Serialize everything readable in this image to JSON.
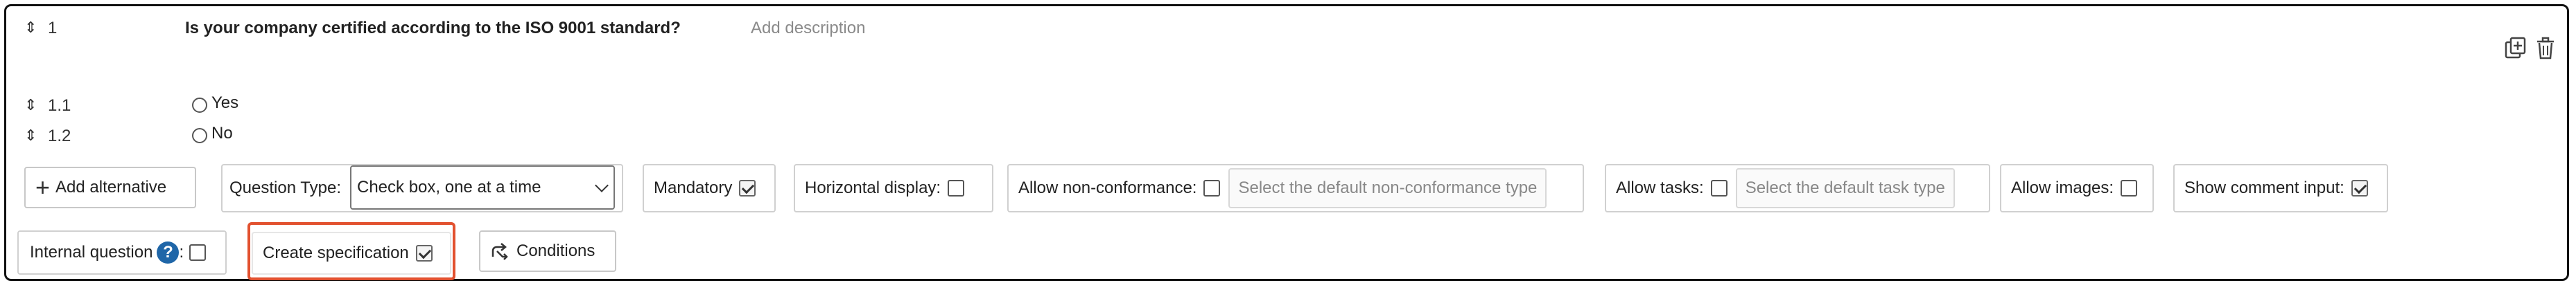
{
  "question": {
    "number": "1",
    "text": "Is your company certified according to the ISO 9001 standard?",
    "description_placeholder": "Add description"
  },
  "alternatives": [
    {
      "number": "1.1",
      "label": "Yes"
    },
    {
      "number": "1.2",
      "label": "No"
    }
  ],
  "toolbar": {
    "add_alternative": "Add alternative",
    "question_type_label": "Question Type:",
    "question_type_value": "Check box, one at a time",
    "mandatory_label": "Mandatory",
    "mandatory_checked": true,
    "horizontal_display_label": "Horizontal display:",
    "horizontal_display_checked": false,
    "allow_nonconformance_label": "Allow non-conformance:",
    "allow_nonconformance_checked": false,
    "nonconformance_placeholder": "Select the default non-conformance type",
    "allow_tasks_label": "Allow tasks:",
    "allow_tasks_checked": false,
    "task_type_placeholder": "Select the default task type",
    "allow_images_label": "Allow images:",
    "allow_images_checked": false,
    "show_comment_label": "Show comment input:",
    "show_comment_checked": true,
    "internal_question_label": "Internal question",
    "internal_question_suffix": ":",
    "internal_question_checked": false,
    "create_specification_label": "Create specification",
    "create_specification_checked": true,
    "conditions_label": "Conditions",
    "help_glyph": "?"
  },
  "icons": {
    "duplicate": "duplicate-icon",
    "delete": "trash-icon",
    "drag": "drag-handle-icon",
    "conditions": "branch-icon"
  },
  "colors": {
    "highlight": "#e2512f",
    "help": "#1f66a8"
  }
}
